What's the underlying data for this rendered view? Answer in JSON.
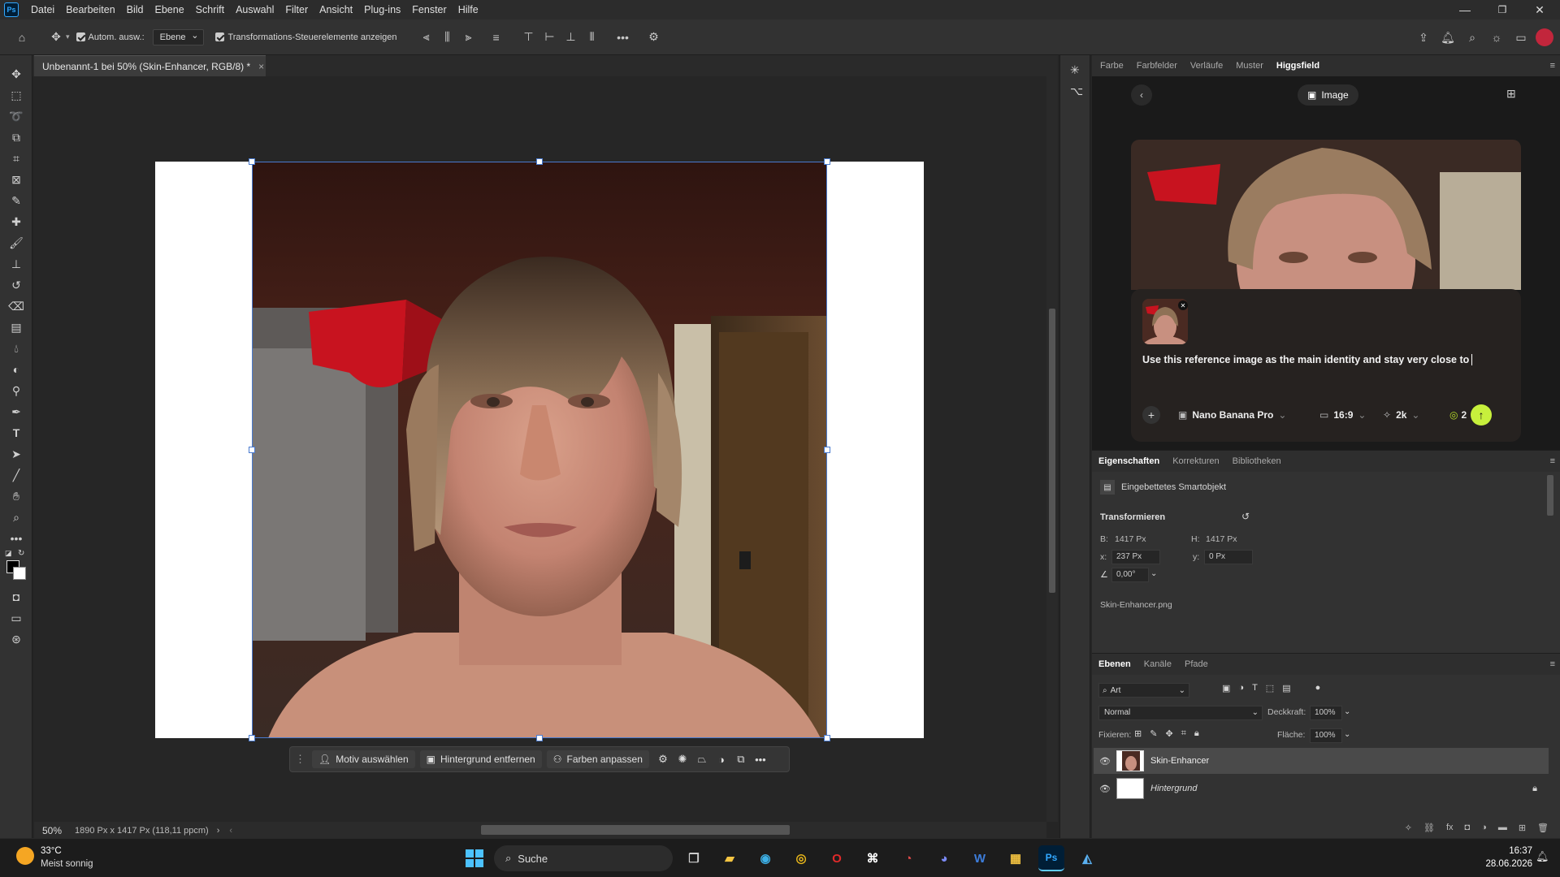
{
  "app": {
    "logo": "Ps"
  },
  "menu": [
    "Datei",
    "Bearbeiten",
    "Bild",
    "Ebene",
    "Schrift",
    "Auswahl",
    "Filter",
    "Ansicht",
    "Plug-ins",
    "Fenster",
    "Hilfe"
  ],
  "options": {
    "auto_select_label": "Autom. ausw.:",
    "auto_select_target": "Ebene",
    "transform_controls_label": "Transformations-Steuerelemente anzeigen"
  },
  "document": {
    "tab_title": "Unbenannt-1 bei 50% (Skin-Enhancer, RGB/8) *",
    "zoom": "50%",
    "size_info": "1890 Px x 1417 Px (118,11 ppcm)"
  },
  "context_bar": {
    "select_subject": "Motiv auswählen",
    "remove_bg": "Hintergrund entfernen",
    "adjust_colors": "Farben anpassen"
  },
  "top_panel": {
    "tabs": [
      "Farbe",
      "Farbfelder",
      "Verläufe",
      "Muster",
      "Higgsfield"
    ],
    "active_tab": "Higgsfield"
  },
  "higgsfield": {
    "mode_label": "Image",
    "prompt_text": "Use this reference image as the main identity and stay very close to",
    "model": "Nano Banana Pro",
    "aspect": "16:9",
    "resolution": "2k",
    "credits": "2"
  },
  "properties": {
    "tabs": [
      "Eigenschaften",
      "Korrekturen",
      "Bibliotheken"
    ],
    "object_type": "Eingebettetes Smartobjekt",
    "transform_title": "Transformieren",
    "w_label": "B:",
    "w_value": "1417 Px",
    "h_label": "H:",
    "h_value": "1417 Px",
    "x_label": "x:",
    "x_value": "237 Px",
    "y_label": "y:",
    "y_value": "0 Px",
    "angle": "0,00°",
    "filename": "Skin-Enhancer.png"
  },
  "layers": {
    "tabs": [
      "Ebenen",
      "Kanäle",
      "Pfade"
    ],
    "filter_label": "Art",
    "blend_mode": "Normal",
    "opacity_label": "Deckkraft:",
    "opacity": "100%",
    "lock_label": "Fixieren:",
    "fill_label": "Fläche:",
    "fill": "100%",
    "items": [
      {
        "name": "Skin-Enhancer",
        "italic": false
      },
      {
        "name": "Hintergrund",
        "italic": true
      }
    ]
  },
  "taskbar": {
    "temperature": "33°C",
    "weather": "Meist sonnig",
    "search": "Suche",
    "time": "16:37",
    "date": "28.06.2026"
  }
}
